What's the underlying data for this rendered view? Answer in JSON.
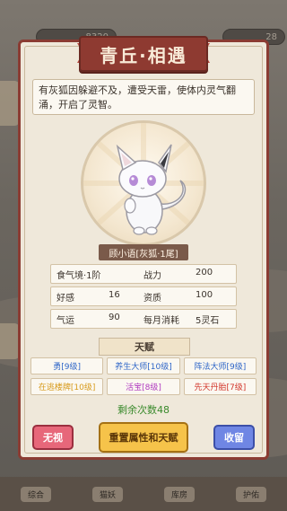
{
  "top": {
    "gold": "8320",
    "day": "28"
  },
  "bottom_nav": [
    "综合",
    "猫妖",
    "库房",
    "护佑"
  ],
  "dialog": {
    "title": "青丘·相遇",
    "description": "有灰狐因躲避不及，遭受天雷，使体内灵气翻涌，开启了灵智。",
    "name_plate": "顾小语[灰狐·1尾]",
    "stats": [
      {
        "l1": "食气境·1阶",
        "v1": "",
        "l2": "战力",
        "v2": "200"
      },
      {
        "l1": "好感",
        "v1": "16",
        "l2": "资质",
        "v2": "100"
      },
      {
        "l1": "气运",
        "v1": "90",
        "l2": "每月消耗",
        "v2": "5灵石"
      }
    ],
    "talent_title": "天赋",
    "talents": [
      {
        "text": "勇[9级]",
        "color": "#2f66c8"
      },
      {
        "text": "养生大师[10级]",
        "color": "#2f66c8"
      },
      {
        "text": "阵法大师[9级]",
        "color": "#2f66c8"
      },
      {
        "text": "在逃楼牌[10级]",
        "color": "#d79a1b"
      },
      {
        "text": "活宝[8级]",
        "color": "#b03ac0"
      },
      {
        "text": "先天丹胎[7级]",
        "color": "#d2352a"
      }
    ],
    "remaining": "剩余次数48",
    "buttons": {
      "ignore": "无视",
      "reset": "重置属性和天赋",
      "keep": "收留"
    }
  }
}
